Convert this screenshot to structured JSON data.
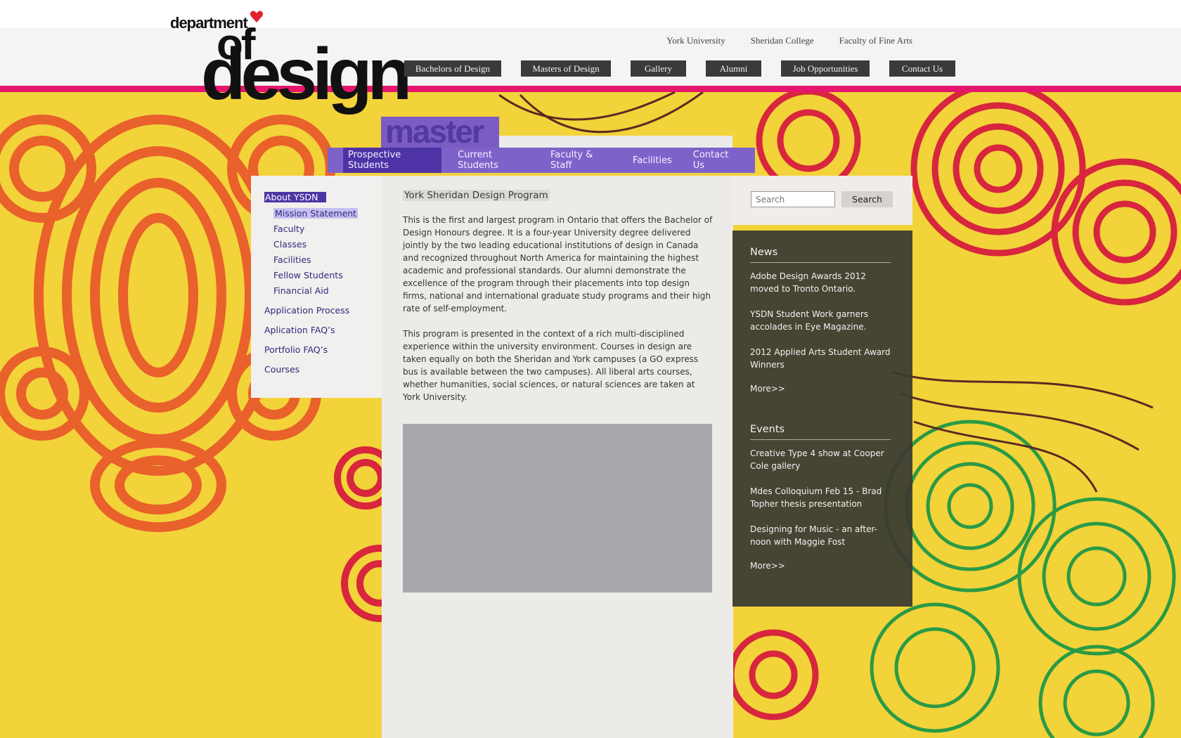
{
  "logo": {
    "line1": "department",
    "line2": "of",
    "line3": "design"
  },
  "top_links": [
    "York University",
    "Sheridan College",
    "Faculty of Fine Arts"
  ],
  "main_nav": [
    "Bachelors of Design",
    "Masters of Design",
    "Gallery",
    "Alumni",
    "Job Opportunities",
    "Contact Us"
  ],
  "section_tab": "master",
  "sub_nav": [
    "Prospective Students",
    "Current Students",
    "Faculty & Staff",
    "Facilities",
    "Contact Us"
  ],
  "left_nav": {
    "active": "About YSDN",
    "sub_items": [
      "Mission Statement",
      "Faculty",
      "Classes",
      "Facilities",
      "Fellow Students",
      "Financial Aid"
    ],
    "items": [
      "Application Process",
      "Aplication FAQ’s",
      "Portfolio FAQ’s",
      "Courses"
    ]
  },
  "content": {
    "title": "York Sheridan Design Program",
    "paragraphs": [
      "This is the first and largest program in Ontario that offers the Bachelor of Design Honours degree. It is a four-year University degree delivered jointly by the two leading educational institutions of design in Canada and recognized throughout North America for maintaining the highest academic and professional standards. Our alumni demonstrate the excellence of the program through their placements into top design firms, national and international graduate study programs and their high rate of self-employment.",
      "This program is presented in the context of a rich multi-disciplined experience within the university environment. Courses in design are taken equally on both the Sheridan and York campuses (a GO express bus is available between the two campuses). All liberal arts courses, whether humanities, social sciences, or natural sciences are taken at York University."
    ]
  },
  "search": {
    "placeholder": "Search",
    "button": "Search"
  },
  "news": {
    "heading": "News",
    "items": [
      "Adobe Design Awards 2012 moved to Tronto Ontario.",
      "YSDN Student Work garners accolades in Eye Magazine.",
      "2012 Applied Arts Student Award Winners"
    ],
    "more": "More>>"
  },
  "events": {
    "heading": "Events",
    "items": [
      "Creative Type 4 show at Cooper Cole gallery",
      "Mdes Colloquium Feb 15 - Brad Topher thesis presentation",
      "Designing for Music - an after-noon with Maggie Fost"
    ],
    "more": "More>>"
  },
  "colors": {
    "accent_pink": "#e6156d",
    "accent_purple": "#7d63c9",
    "active_purple": "#4c35a4",
    "background_yellow": "#f2d33a"
  }
}
